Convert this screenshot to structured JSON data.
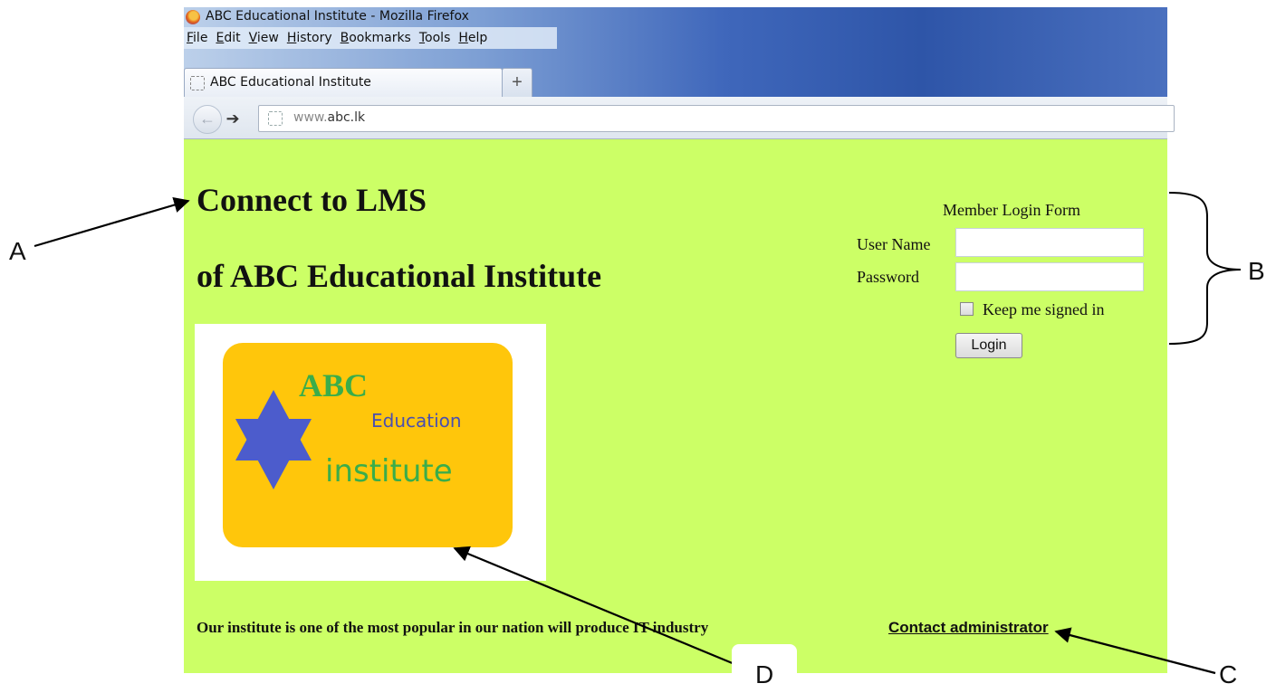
{
  "browser": {
    "window_title": "ABC Educational Institute - Mozilla Firefox",
    "menu": [
      "File",
      "Edit",
      "View",
      "History",
      "Bookmarks",
      "Tools",
      "Help"
    ],
    "tab_title": "ABC Educational Institute",
    "new_tab_label": "+",
    "back_glyph": "←",
    "forward_glyph": "➔",
    "url_prefix": "www.",
    "url_domain": "abc.lk"
  },
  "page": {
    "heading_line1": "Connect to LMS",
    "heading_line2": "of ABC Educational Institute",
    "logo": {
      "line1": "ABC",
      "line2": "Education",
      "line3": "institute",
      "star_color": "#4c5ccc",
      "card_color": "#ffc60b"
    },
    "tagline": "Our institute is one of the most popular in our nation will produce IT industry",
    "contact_link": "Contact administrator",
    "background_color": "#ccff66"
  },
  "login_form": {
    "title": "Member Login Form",
    "username_label": "User Name",
    "username_value": "",
    "password_label": "Password",
    "password_value": "",
    "keep_signed_in_label": "Keep me signed in",
    "keep_signed_in_checked": false,
    "login_button": "Login"
  },
  "callouts": {
    "a": "A",
    "b": "B",
    "c": "C",
    "d": "D"
  }
}
